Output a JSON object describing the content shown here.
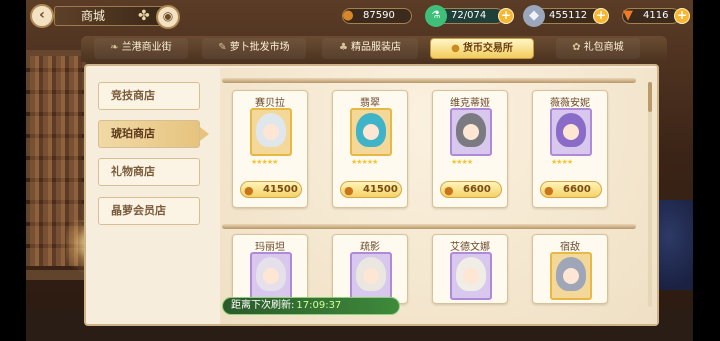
{
  "header": {
    "title": "商城",
    "resources": [
      {
        "name": "carrot-coin",
        "value": "87590",
        "icon": "🥕",
        "color": "#d9862a"
      },
      {
        "name": "stamina",
        "value": "72/074",
        "icon": "🧪",
        "color": "#3fbf7a"
      },
      {
        "name": "diamond",
        "value": "455112",
        "icon": "◆",
        "color": "#cdd6e6"
      },
      {
        "name": "carrot",
        "value": "4116",
        "icon": "🥕",
        "color": "#f07a2a"
      }
    ]
  },
  "tabs": [
    {
      "label": "兰港商业街",
      "active": false
    },
    {
      "label": "萝卜批发市场",
      "active": false
    },
    {
      "label": "精品服装店",
      "active": false
    },
    {
      "label": "货币交易所",
      "active": true
    },
    {
      "label": "礼包商城",
      "active": false
    }
  ],
  "sidebar": {
    "items": [
      {
        "label": "竞技商店",
        "active": false
      },
      {
        "label": "琥珀商店",
        "active": true
      },
      {
        "label": "礼物商店",
        "active": false
      },
      {
        "label": "晶萝会员店",
        "active": false
      }
    ]
  },
  "shop": {
    "row1": [
      {
        "name": "赛贝拉",
        "price": "41500",
        "stars": "★★★★★",
        "hair": "#dfe6ec",
        "frame": "gold"
      },
      {
        "name": "翡翠",
        "price": "41500",
        "stars": "★★★★★",
        "hair": "#3fb4c8",
        "frame": "gold"
      },
      {
        "name": "维克蒂娅",
        "price": "6600",
        "stars": "★★★★",
        "hair": "#7a7a80",
        "frame": "purple"
      },
      {
        "name": "薇薇安妮",
        "price": "6600",
        "stars": "★★★★",
        "hair": "#8a6cc8",
        "frame": "purple"
      }
    ],
    "row2": [
      {
        "name": "玛丽坦",
        "hair": "#e6e0ea",
        "frame": "purple"
      },
      {
        "name": "疏影",
        "hair": "#eae6e0",
        "frame": "purple"
      },
      {
        "name": "艾德文娜",
        "hair": "#f0ece6",
        "frame": "purple"
      },
      {
        "name": "宿敌",
        "hair": "#9fa6b8",
        "frame": "gold"
      }
    ]
  },
  "timer": {
    "label": "距离下次刷新:",
    "value": "17:09:37"
  }
}
